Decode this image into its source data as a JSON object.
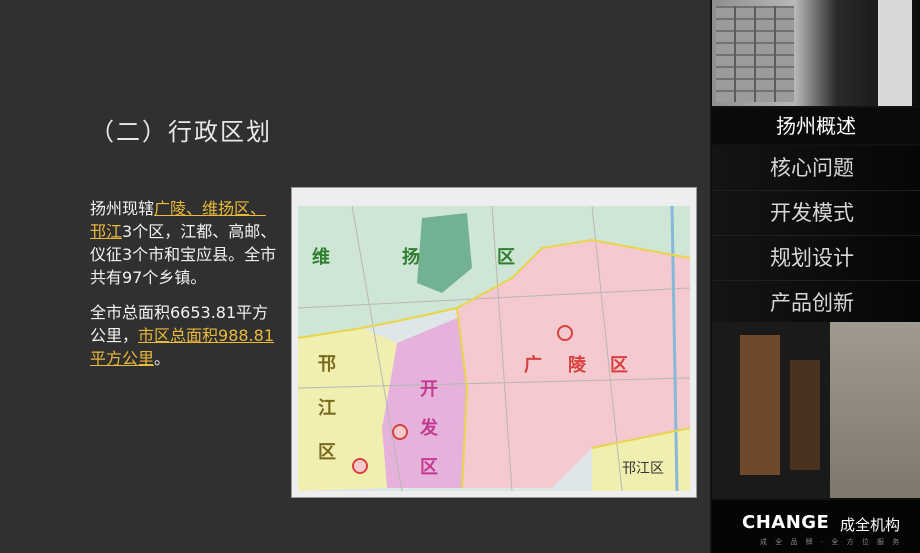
{
  "slide": {
    "heading": "（二）行政区划",
    "para1": {
      "prefix": "扬州现辖",
      "highlight": "广陵、维扬区、邗江",
      "suffix": "3个区，江都、高邮、仪征3个市和宝应县。全市共有97个乡镇。"
    },
    "para2": {
      "prefix": "全市总面积6653.81平方公里，",
      "highlight": "市区总面积988.81平方公里",
      "suffix": "。"
    }
  },
  "map": {
    "labels": {
      "weiyang": [
        "维",
        "扬",
        "区"
      ],
      "guangling": [
        "广",
        "陵",
        "区"
      ],
      "hanjiang_left": [
        "邗",
        "江",
        "区"
      ],
      "kaifa": [
        "开",
        "发",
        "区"
      ],
      "hanjiang_bottom": "邗江区"
    },
    "colors": {
      "weiyang": "#cfe6d6",
      "guangling": "#f4c9cf",
      "kaifa": "#e6b2dc",
      "hanjiang": "#f1efb0",
      "label": "#2f7d2f",
      "label_red": "#d9413f"
    }
  },
  "sidebar": {
    "title": "扬州概述",
    "items": [
      "核心问题",
      "开发模式",
      "规划设计",
      "产品创新"
    ]
  },
  "brand": {
    "logo": "CHANGE",
    "name": "成全机构",
    "tagline": "成 全 品 牌 · 全 方 位 服 务"
  }
}
